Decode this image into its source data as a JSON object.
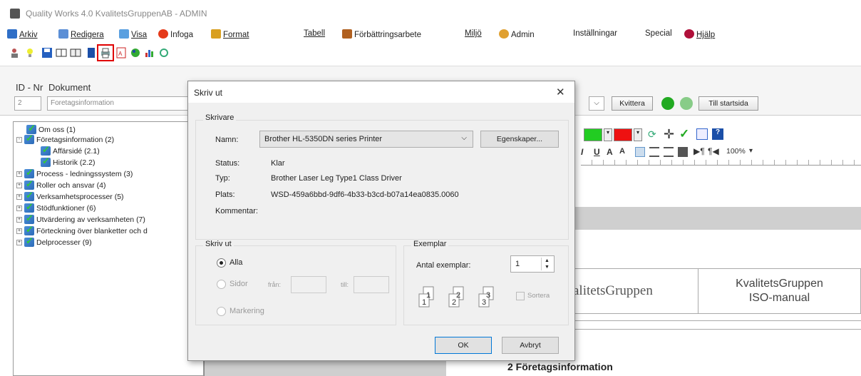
{
  "window": {
    "title": "Quality Works 4.0 KvalitetsGruppenAB - ADMIN"
  },
  "menu": [
    {
      "label": "Arkiv",
      "color": "#2f6fc7"
    },
    {
      "label": "Redigera",
      "color": "#5b8fd6"
    },
    {
      "label": "Visa",
      "color": "#5aa0e0"
    },
    {
      "label": "Infoga",
      "color": "#e53a1a"
    },
    {
      "label": "Format",
      "color": "#d9a020"
    },
    {
      "label": "Tabell",
      "color": ""
    },
    {
      "label": "Förbättringsarbete",
      "color": "#b06020"
    },
    {
      "label": "Miljö",
      "color": ""
    },
    {
      "label": "Admin",
      "color": "#e0a030"
    },
    {
      "label": "Inställningar",
      "color": ""
    },
    {
      "label": "Special",
      "color": ""
    },
    {
      "label": "Hjälp",
      "color": "#b0103a"
    }
  ],
  "fields": {
    "id_label": "ID - Nr",
    "doc_label": "Dokument",
    "id_value": "2",
    "doc_value": "Foretagsinformation",
    "kvittera": "Kvittera",
    "till_startsida": "Till startsida"
  },
  "tree": [
    {
      "label": "Om oss (1)",
      "level": 1,
      "exp": ""
    },
    {
      "label": "Företagsinformation (2)",
      "level": 0,
      "exp": "-"
    },
    {
      "label": "Affärsidé (2.1)",
      "level": 2,
      "exp": ""
    },
    {
      "label": "Historik (2.2)",
      "level": 2,
      "exp": ""
    },
    {
      "label": "Process - ledningssystem (3)",
      "level": 0,
      "exp": "+"
    },
    {
      "label": "Roller och ansvar (4)",
      "level": 0,
      "exp": "+"
    },
    {
      "label": "Verksamhetsprocesser (5)",
      "level": 0,
      "exp": "+"
    },
    {
      "label": "Stödfunktioner (6)",
      "level": 0,
      "exp": "+"
    },
    {
      "label": "Utvärdering av verksamheten (7)",
      "level": 0,
      "exp": "+"
    },
    {
      "label": "Förteckning över blanketter och d",
      "level": 0,
      "exp": "+"
    },
    {
      "label": "Delprocesser (9)",
      "level": 0,
      "exp": "+"
    }
  ],
  "format_bar": {
    "zoom": "100%"
  },
  "doc": {
    "cell1": "alitetsGruppen",
    "cell2_line1": "KvalitetsGruppen",
    "cell2_line2": "ISO-manual",
    "heading": "2 Företagsinformation"
  },
  "dialog": {
    "title": "Skriv ut",
    "close": "✕",
    "printer_group": "Skrivare",
    "name_label": "Namn:",
    "name_value": "Brother HL-5350DN series Printer",
    "properties": "Egenskaper...",
    "status_label": "Status:",
    "status_value": "Klar",
    "type_label": "Typ:",
    "type_value": "Brother Laser Leg Type1 Class Driver",
    "where_label": "Plats:",
    "where_value": "WSD-459a6bbd-9df6-4b33-b3cd-b07a14ea0835.0060",
    "comment_label": "Kommentar:",
    "range_group": "Skriv ut",
    "all": "Alla",
    "pages": "Sidor",
    "from": "från:",
    "to": "till:",
    "selection": "Markering",
    "copies_group": "Exemplar",
    "copies_label": "Antal exemplar:",
    "copies_value": "1",
    "collate": "Sortera",
    "ok": "OK",
    "cancel": "Avbryt"
  }
}
